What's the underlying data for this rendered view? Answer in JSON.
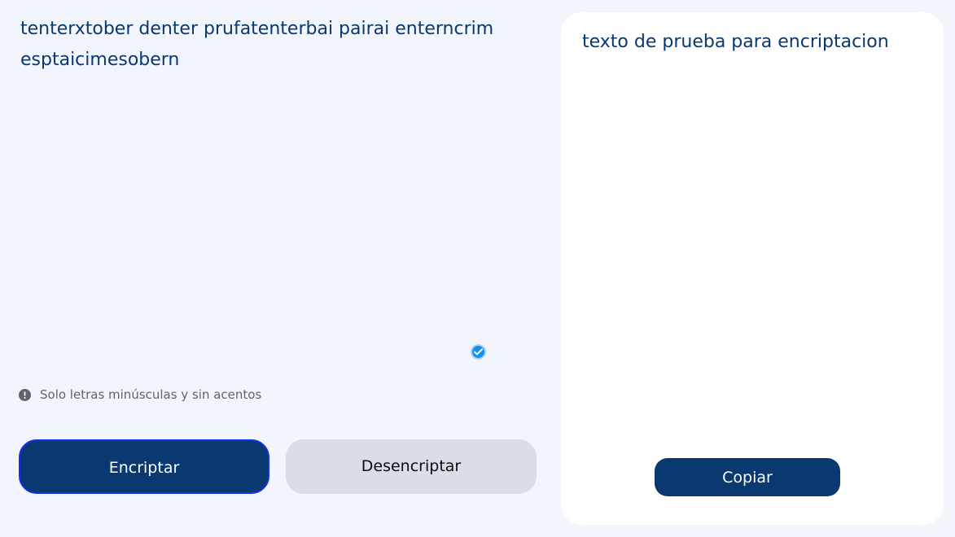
{
  "input": {
    "text": "tenterxtober denter prufatenterbai pairai enterncrimesptaicimesobern"
  },
  "hint": {
    "icon": "exclamation-circle-icon",
    "text": "Solo letras minúsculas y sin acentos"
  },
  "status_badge": {
    "icon": "check-circle-icon",
    "color": "#1b8fe8"
  },
  "buttons": {
    "encrypt_label": "Encriptar",
    "decrypt_label": "Desencriptar"
  },
  "output": {
    "text": "texto de prueba para encriptacion",
    "copy_label": "Copiar"
  },
  "colors": {
    "background": "#f2f5fc",
    "primary": "#0a3871",
    "secondary_button": "#d8dde6",
    "card": "#ffffff",
    "hint_text": "#5d6470"
  }
}
